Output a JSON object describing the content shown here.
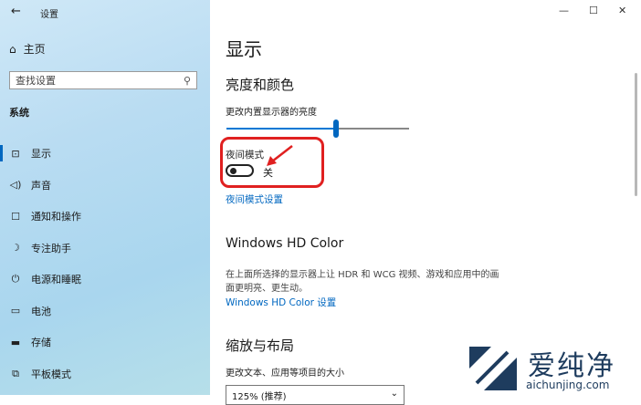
{
  "window": {
    "title": "设置",
    "minimize": "—",
    "maximize": "☐",
    "close": "✕"
  },
  "sidebar": {
    "back": "←",
    "home": "主页",
    "search_placeholder": "查找设置",
    "section": "系统",
    "items": [
      {
        "label": "显示",
        "icon": "⊡",
        "icon_name": "display-icon"
      },
      {
        "label": "声音",
        "icon": "🔈",
        "icon_name": "speaker-icon"
      },
      {
        "label": "通知和操作",
        "icon": "☐",
        "icon_name": "notification-icon"
      },
      {
        "label": "专注助手",
        "icon": "☽",
        "icon_name": "moon-icon"
      },
      {
        "label": "电源和睡眠",
        "icon": "⏻",
        "icon_name": "power-icon"
      },
      {
        "label": "电池",
        "icon": "▭",
        "icon_name": "battery-icon"
      },
      {
        "label": "存储",
        "icon": "▭",
        "icon_name": "storage-icon"
      },
      {
        "label": "平板模式",
        "icon": "⧉",
        "icon_name": "tablet-icon"
      }
    ],
    "active_index": 0
  },
  "main": {
    "title": "显示",
    "brightness_header": "亮度和颜色",
    "brightness_label": "更改内置显示器的亮度",
    "brightness_value": 0.6,
    "night_light_label": "夜间模式",
    "night_light_state": "关",
    "night_light_settings_link": "夜间模式设置",
    "hdr_header": "Windows HD Color",
    "hdr_desc_line1": "在上面所选择的显示器上让 HDR 和 WCG 视频、游戏和应用中的画",
    "hdr_desc_line2": "面更明亮、更生动。",
    "hdr_link": "Windows HD Color 设置",
    "scale_header": "缩放与布局",
    "scale_label": "更改文本、应用等项目的大小",
    "scale_value": "125% (推荐)"
  },
  "watermark": {
    "text_cn": "爱纯净",
    "text_en": "aichunjing.com"
  },
  "colors": {
    "accent": "#0067c0",
    "highlight": "#e02020"
  }
}
